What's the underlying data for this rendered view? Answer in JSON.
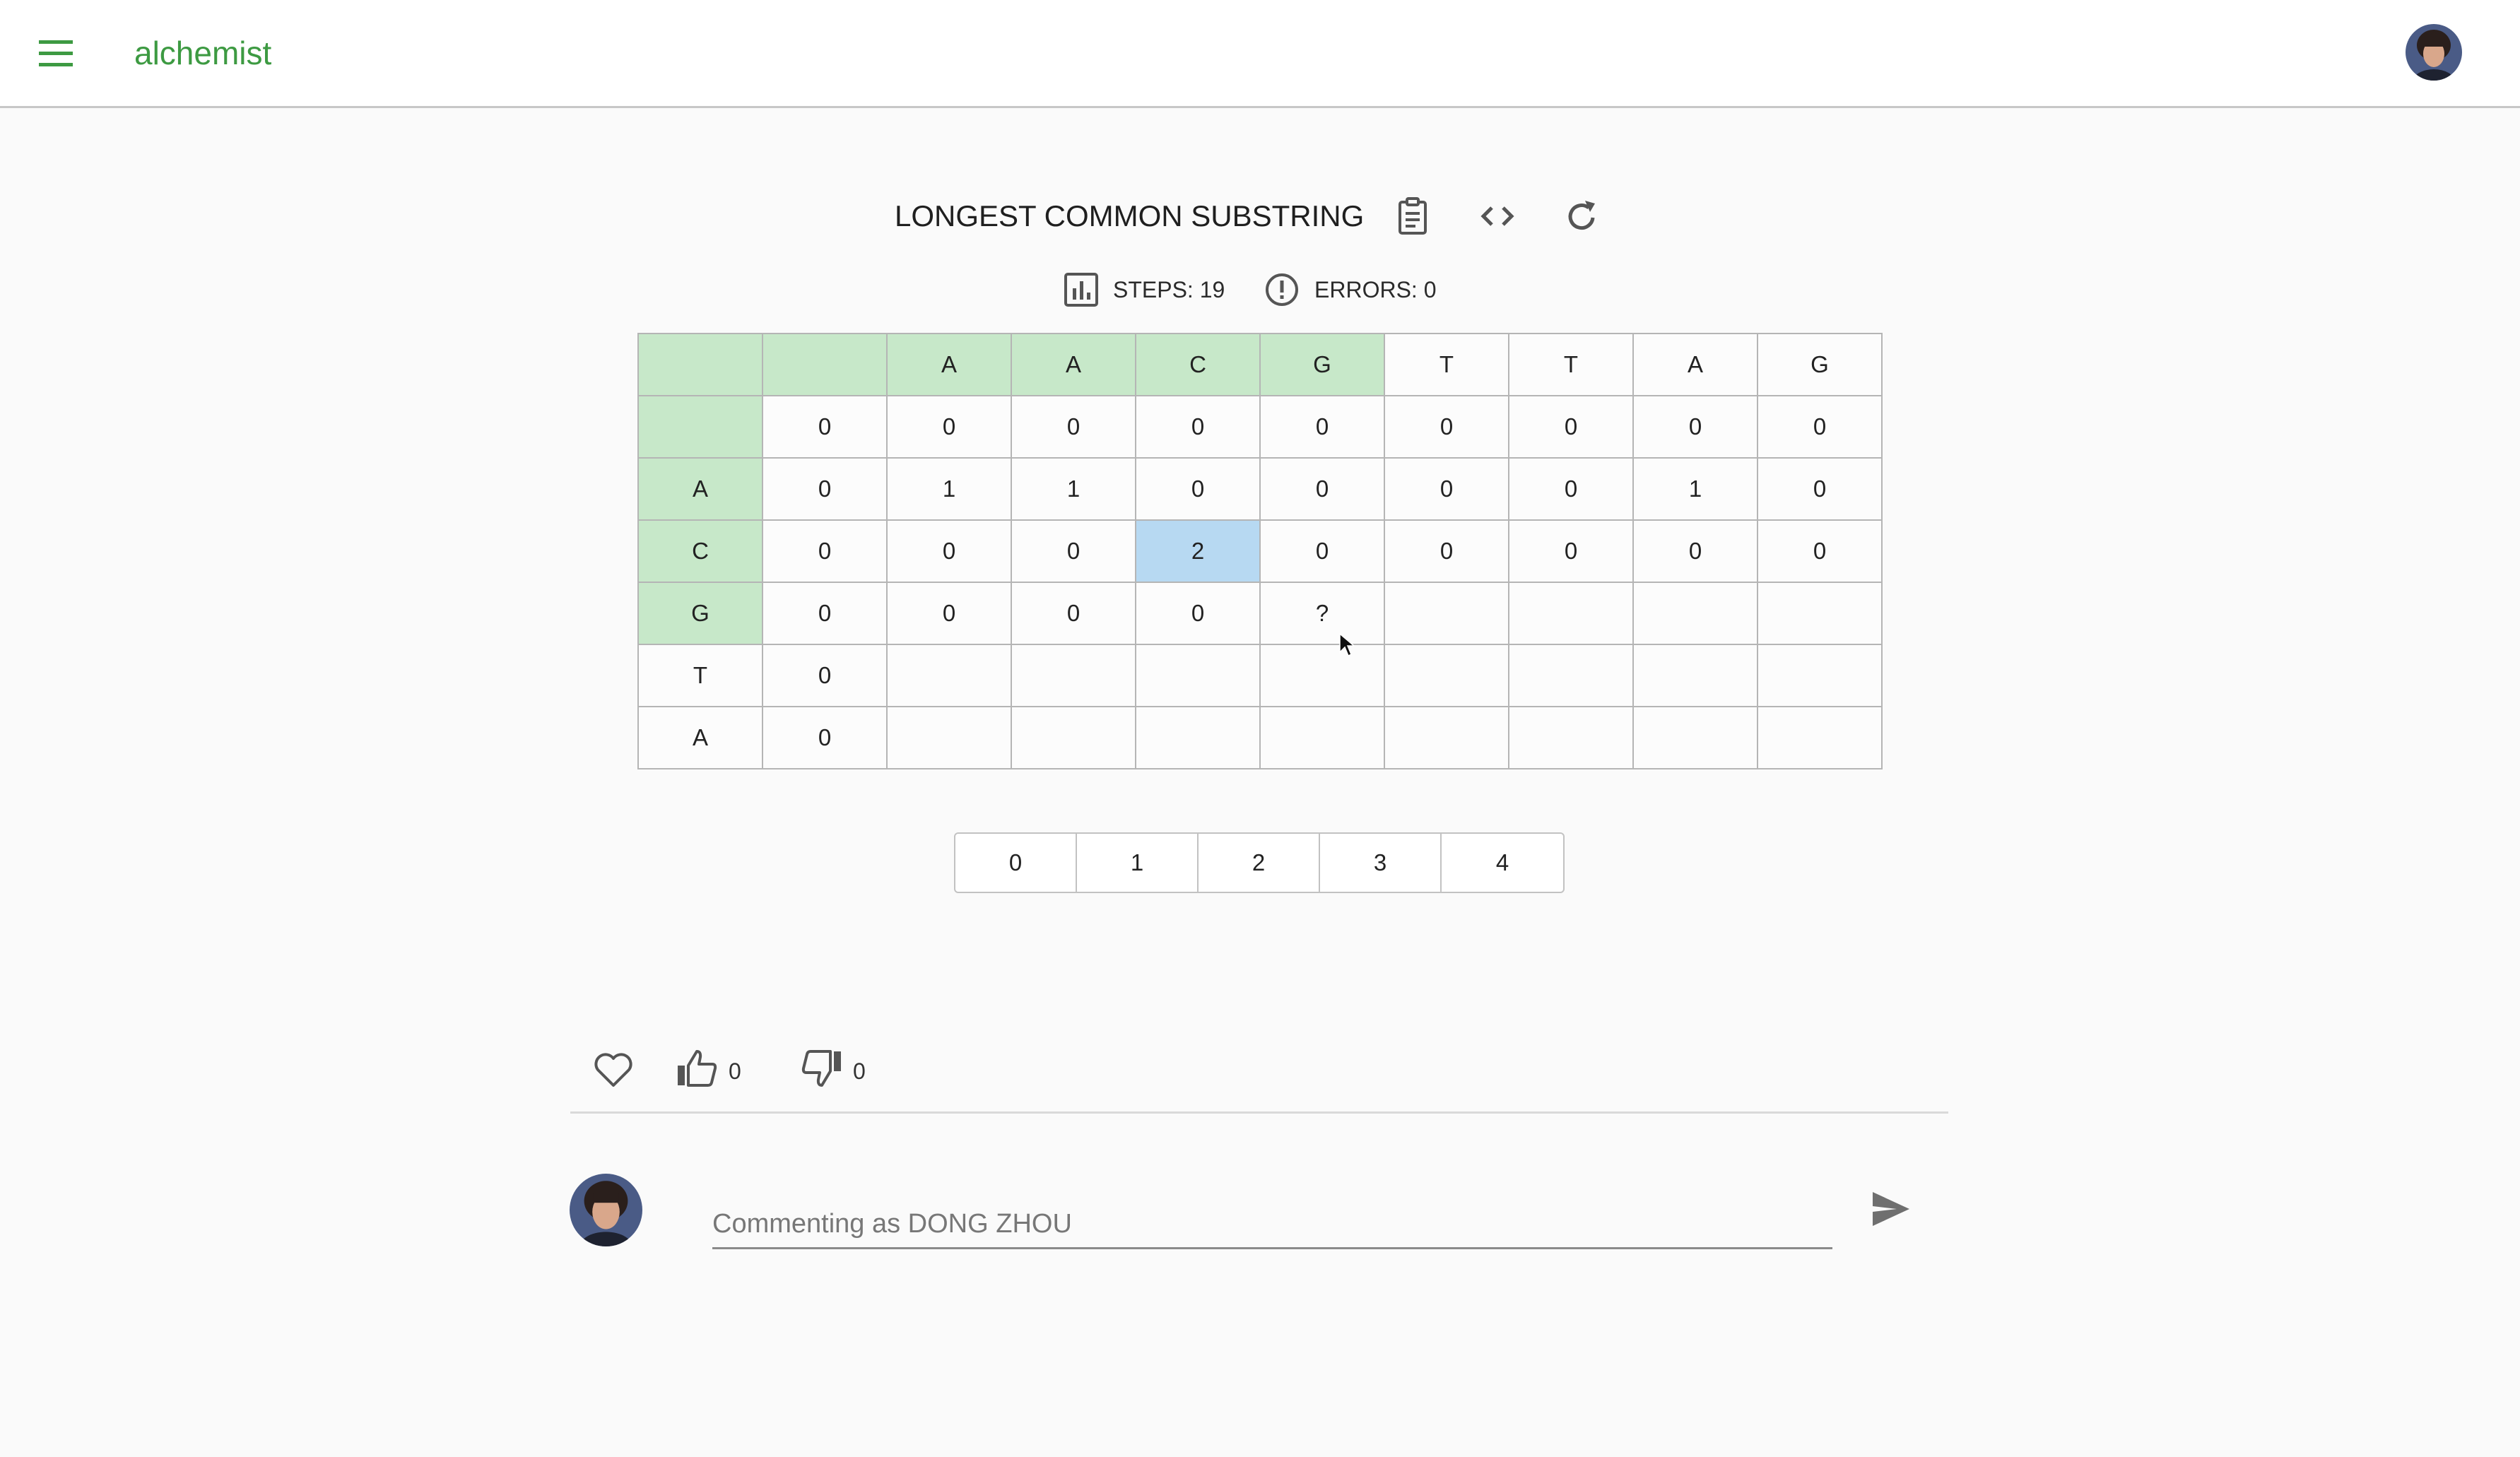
{
  "app": {
    "brand": "alchemist"
  },
  "problem": {
    "title": "LONGEST COMMON SUBSTRING",
    "steps_text": "STEPS: 19",
    "errors_text": "ERRORS: 0"
  },
  "table": {
    "rows": [
      [
        "",
        "",
        "A",
        "A",
        "C",
        "G",
        "T",
        "T",
        "A",
        "G"
      ],
      [
        "",
        "0",
        "0",
        "0",
        "0",
        "0",
        "0",
        "0",
        "0",
        "0"
      ],
      [
        "A",
        "0",
        "1",
        "1",
        "0",
        "0",
        "0",
        "0",
        "1",
        "0"
      ],
      [
        "C",
        "0",
        "0",
        "0",
        "2",
        "0",
        "0",
        "0",
        "0",
        "0"
      ],
      [
        "G",
        "0",
        "0",
        "0",
        "0",
        "?",
        "",
        "",
        "",
        ""
      ],
      [
        "T",
        "0",
        "",
        "",
        "",
        "",
        "",
        "",
        "",
        ""
      ],
      [
        "A",
        "0",
        "",
        "",
        "",
        "",
        "",
        "",
        "",
        ""
      ]
    ]
  },
  "choices": [
    "0",
    "1",
    "2",
    "3",
    "4"
  ],
  "reactions": {
    "likes": "0",
    "dislikes": "0"
  },
  "comment": {
    "placeholder": "Commenting as DONG ZHOU"
  },
  "icons": {
    "menu": "menu-icon",
    "clipboard": "clipboard-icon",
    "code": "code-icon",
    "refresh": "refresh-icon",
    "steps": "bar-chart-icon",
    "errors": "alert-circle-icon",
    "heart": "heart-icon",
    "thumbs_up": "thumbs-up-icon",
    "thumbs_down": "thumbs-down-icon",
    "send": "send-icon"
  },
  "colors": {
    "brand": "#3d9a42",
    "header_cell": "#c7e8c9",
    "current_cell": "#b7d9f2"
  }
}
